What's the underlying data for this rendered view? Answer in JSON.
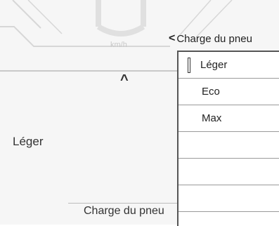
{
  "speed": {
    "unit": "km/h"
  },
  "tire_pressure_menu": {
    "back_label": "Charge du pneu",
    "items": [
      {
        "label": "Léger",
        "selected": true
      },
      {
        "label": "Eco",
        "selected": false
      },
      {
        "label": "Max",
        "selected": false
      },
      {
        "label": "",
        "selected": false
      },
      {
        "label": "",
        "selected": false
      },
      {
        "label": "",
        "selected": false
      }
    ]
  },
  "left_panel": {
    "value": "Léger",
    "setting_label": "Charge du pneu"
  },
  "colors": {
    "selection_border": "#333333",
    "divider": "#9a9a9a",
    "background": "#f6f6f6"
  }
}
